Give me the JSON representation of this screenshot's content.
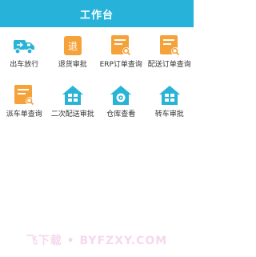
{
  "header": {
    "title": "工作台"
  },
  "grid": {
    "items": [
      {
        "label": "出车放行",
        "icon": "truck-icon",
        "color": "#29b3d6"
      },
      {
        "label": "退货审批",
        "icon": "return-doc-icon",
        "color": "#f5a23a"
      },
      {
        "label": "ERP订单查询",
        "icon": "doc-search-icon",
        "color": "#f5a23a"
      },
      {
        "label": "配送订单查询",
        "icon": "doc-search-icon",
        "color": "#f5a23a"
      },
      {
        "label": "派车单查询",
        "icon": "doc-search-icon",
        "color": "#f5a23a"
      },
      {
        "label": "二次配送审批",
        "icon": "warehouse-grid-icon",
        "color": "#29b3d6"
      },
      {
        "label": "仓库查看",
        "icon": "warehouse-view-icon",
        "color": "#29b3d6"
      },
      {
        "label": "转车审批",
        "icon": "warehouse-grid-icon",
        "color": "#29b3d6"
      }
    ]
  },
  "watermark": "飞下载 • BYFZXY.COM"
}
